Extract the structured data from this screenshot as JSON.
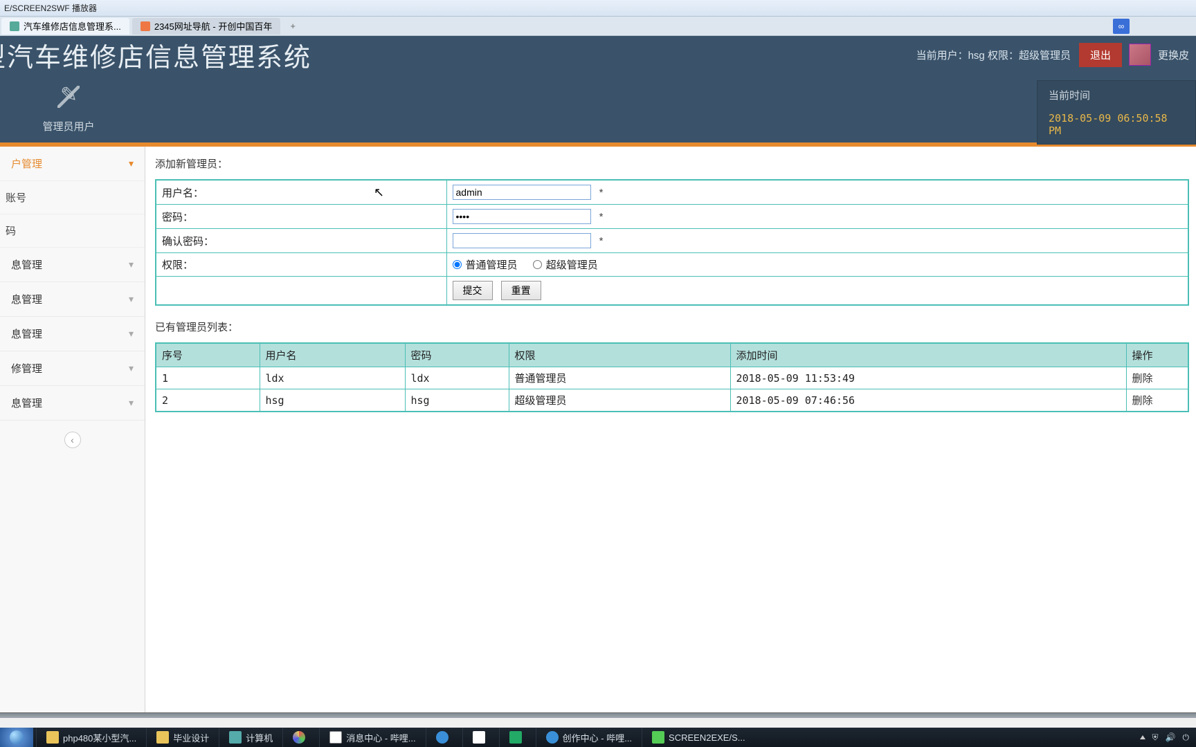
{
  "window": {
    "title": "E/SCREEN2SWF 播放器"
  },
  "tabs": {
    "t1": "汽车维修店信息管理系...",
    "t2": "2345网址导航 - 开创中国百年",
    "new": "+"
  },
  "extension": {
    "label": ""
  },
  "header": {
    "app_title": "型汽车维修店信息管理系统",
    "user_prefix": "当前用户：",
    "user_name": "hsg",
    "perm_prefix": " 权限：",
    "perm_value": "超级管理员",
    "logout": "退出",
    "switch": "更换皮"
  },
  "toolbar": {
    "item_label": "管理员用户",
    "clock_label": "当前时间",
    "clock_value": "2018-05-09 06:50:58 PM"
  },
  "sidebar": {
    "items": [
      {
        "label": "户管理",
        "expandable": true,
        "active": true
      },
      {
        "label": "账号",
        "expandable": false
      },
      {
        "label": "码",
        "expandable": false
      },
      {
        "label": "息管理",
        "expandable": true
      },
      {
        "label": "息管理",
        "expandable": true
      },
      {
        "label": "息管理",
        "expandable": true
      },
      {
        "label": "修管理",
        "expandable": true
      },
      {
        "label": "息管理",
        "expandable": true
      }
    ],
    "collapse_glyph": "‹"
  },
  "form": {
    "heading": "添加新管理员：",
    "username_label": "用户名：",
    "username_value": "admin",
    "password_label": "密码：",
    "password_value": "1234",
    "confirm_label": "确认密码：",
    "confirm_value": "",
    "perm_label": "权限：",
    "perm_normal": "普通管理员",
    "perm_super": "超级管理员",
    "submit": "提交",
    "reset": "重置",
    "req": "*"
  },
  "list": {
    "heading": "已有管理员列表：",
    "columns": {
      "c0": "序号",
      "c1": "用户名",
      "c2": "密码",
      "c3": "权限",
      "c4": "添加时间",
      "c5": "操作"
    },
    "rows": [
      {
        "idx": "1",
        "user": "ldx",
        "pwd": "ldx",
        "perm": "普通管理员",
        "time": "2018-05-09 11:53:49",
        "op": "删除"
      },
      {
        "idx": "2",
        "user": "hsg",
        "pwd": "hsg",
        "perm": "超级管理员",
        "time": "2018-05-09 07:46:56",
        "op": "删除"
      }
    ]
  },
  "taskbar": {
    "items": [
      "php480某小型汽...",
      "毕业设计",
      "计算机",
      "",
      "消息中心 - 哔哩...",
      "",
      "",
      "",
      "创作中心 - 哔哩...",
      "SCREEN2EXE/S..."
    ]
  }
}
